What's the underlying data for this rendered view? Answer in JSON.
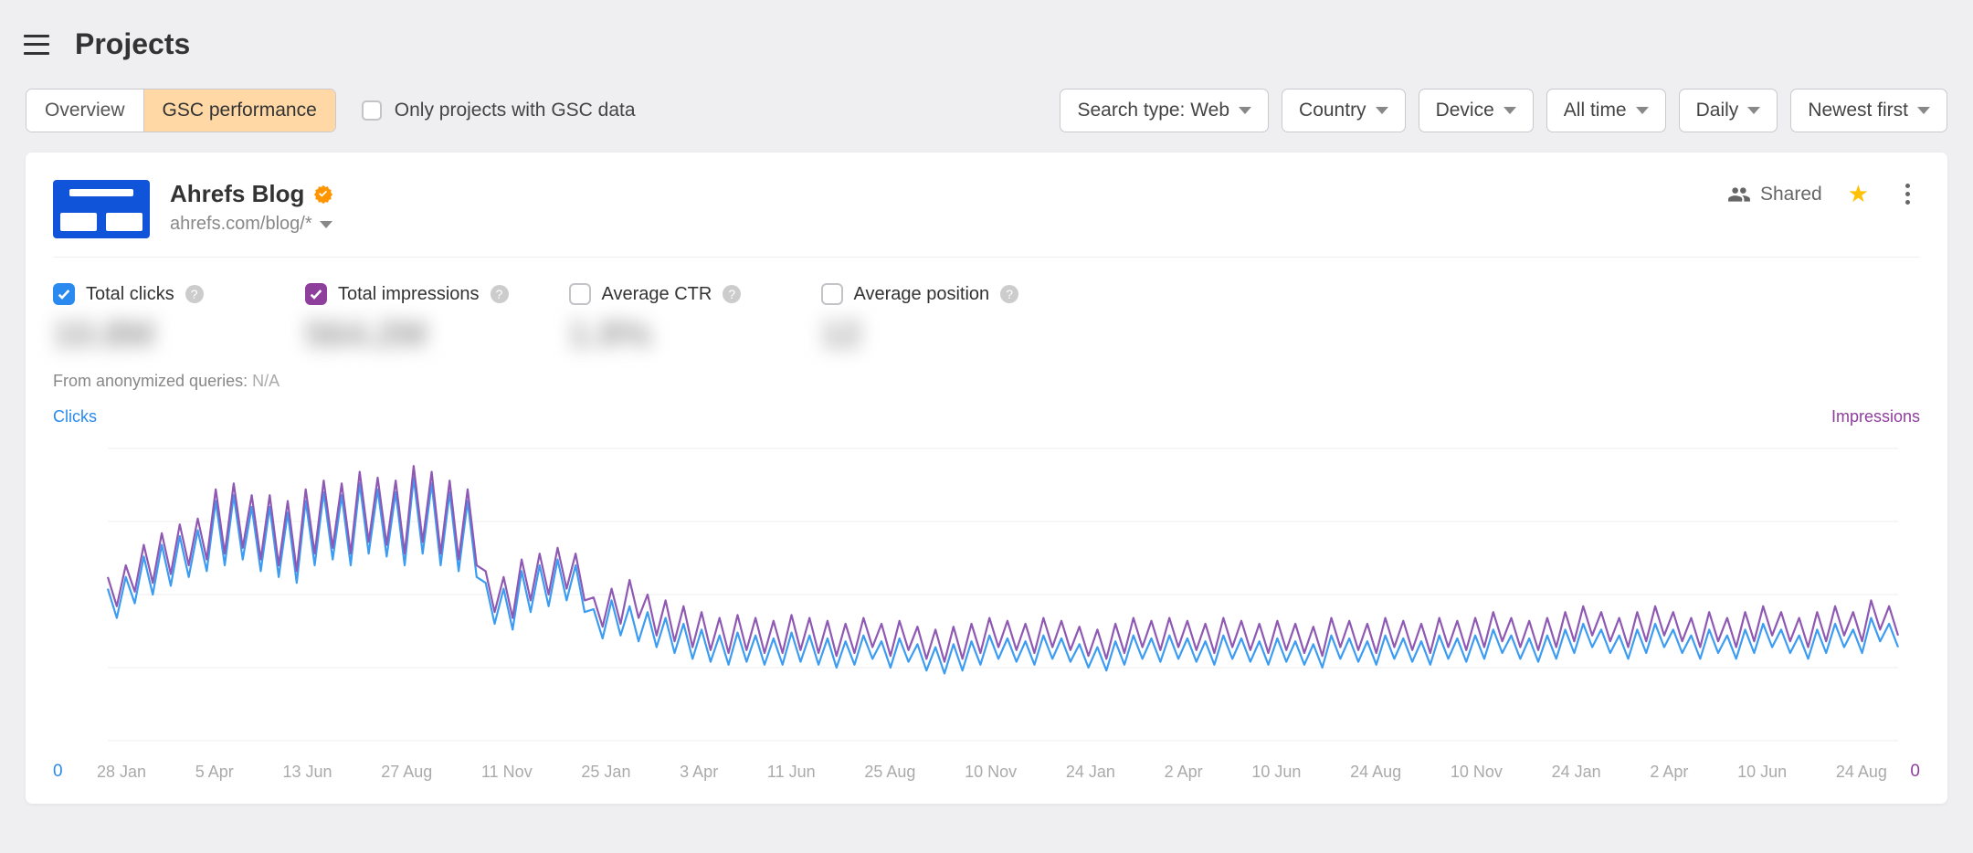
{
  "page": {
    "title": "Projects"
  },
  "tabs": {
    "overview": "Overview",
    "gsc": "GSC performance"
  },
  "only_gsc": {
    "label": "Only projects with GSC data",
    "checked": false
  },
  "filters": {
    "search_type": "Search type: Web",
    "country": "Country",
    "device": "Device",
    "time": "All time",
    "granularity": "Daily",
    "sort": "Newest first"
  },
  "project": {
    "name": "Ahrefs Blog",
    "domain": "ahrefs.com/blog/*",
    "shared_label": "Shared"
  },
  "metrics": {
    "total_clicks": {
      "label": "Total clicks",
      "value": "10.8M",
      "checked": true
    },
    "total_impressions": {
      "label": "Total impressions",
      "value": "564.2M",
      "checked": true
    },
    "avg_ctr": {
      "label": "Average CTR",
      "value": "1.9%",
      "checked": false
    },
    "avg_position": {
      "label": "Average position",
      "value": "12",
      "checked": false
    }
  },
  "anon": {
    "label": "From anonymized queries:",
    "value": "N/A"
  },
  "axis": {
    "left_label": "Clicks",
    "right_label": "Impressions",
    "left_zero": "0",
    "right_zero": "0"
  },
  "xticks": [
    "28 Jan",
    "5 Apr",
    "13 Jun",
    "27 Aug",
    "11 Nov",
    "25 Jan",
    "3 Apr",
    "11 Jun",
    "25 Aug",
    "10 Nov",
    "24 Jan",
    "2 Apr",
    "10 Jun",
    "24 Aug",
    "10 Nov",
    "24 Jan",
    "2 Apr",
    "10 Jun",
    "24 Aug"
  ],
  "chart_data": {
    "type": "line",
    "xlabel": "",
    "ylabel_left": "Clicks",
    "ylabel_right": "Impressions",
    "x_ticks": [
      "28 Jan",
      "5 Apr",
      "13 Jun",
      "27 Aug",
      "11 Nov",
      "25 Jan",
      "3 Apr",
      "11 Jun",
      "25 Aug",
      "10 Nov",
      "24 Jan",
      "2 Apr",
      "10 Jun",
      "24 Aug",
      "10 Nov",
      "24 Jan",
      "2 Apr",
      "10 Jun",
      "24 Aug"
    ],
    "ylim": [
      0,
      100
    ],
    "series": [
      {
        "name": "Total clicks",
        "color": "#3b9cf2",
        "values": [
          52,
          42,
          56,
          47,
          63,
          50,
          67,
          53,
          70,
          56,
          72,
          58,
          82,
          60,
          84,
          62,
          80,
          58,
          80,
          56,
          78,
          54,
          82,
          60,
          85,
          62,
          84,
          60,
          88,
          64,
          86,
          63,
          85,
          60,
          90,
          64,
          88,
          60,
          85,
          58,
          82,
          56,
          54,
          40,
          52,
          38,
          58,
          44,
          60,
          46,
          62,
          48,
          60,
          44,
          45,
          35,
          48,
          36,
          46,
          34,
          44,
          32,
          42,
          30,
          40,
          28,
          38,
          27,
          36,
          26,
          37,
          27,
          36,
          26,
          35,
          26,
          37,
          27,
          36,
          26,
          35,
          25,
          34,
          26,
          36,
          28,
          34,
          25,
          35,
          27,
          33,
          24,
          32,
          23,
          33,
          24,
          34,
          26,
          36,
          28,
          35,
          27,
          34,
          26,
          36,
          28,
          35,
          27,
          33,
          25,
          32,
          24,
          34,
          26,
          36,
          28,
          35,
          27,
          36,
          28,
          35,
          27,
          34,
          26,
          36,
          28,
          35,
          27,
          34,
          26,
          35,
          27,
          34,
          26,
          33,
          25,
          36,
          28,
          35,
          27,
          34,
          26,
          36,
          28,
          35,
          27,
          34,
          26,
          36,
          28,
          35,
          27,
          36,
          28,
          38,
          30,
          36,
          28,
          35,
          27,
          36,
          28,
          38,
          30,
          40,
          32,
          38,
          30,
          36,
          28,
          38,
          30,
          40,
          32,
          38,
          30,
          36,
          28,
          38,
          30,
          36,
          28,
          38,
          30,
          40,
          32,
          38,
          30,
          36,
          28,
          38,
          30,
          40,
          32,
          38,
          30,
          42,
          34,
          40,
          32
        ]
      },
      {
        "name": "Total impressions",
        "color": "#8e58b3",
        "values": [
          56,
          46,
          60,
          51,
          67,
          54,
          71,
          57,
          74,
          60,
          76,
          62,
          86,
          64,
          88,
          66,
          84,
          62,
          84,
          60,
          82,
          58,
          86,
          64,
          89,
          66,
          88,
          64,
          92,
          68,
          90,
          67,
          89,
          64,
          94,
          68,
          92,
          64,
          89,
          62,
          86,
          60,
          58,
          44,
          56,
          42,
          62,
          48,
          64,
          50,
          66,
          52,
          64,
          48,
          49,
          39,
          52,
          40,
          55,
          42,
          50,
          36,
          48,
          34,
          46,
          32,
          44,
          31,
          42,
          30,
          43,
          31,
          42,
          30,
          41,
          30,
          43,
          31,
          42,
          30,
          41,
          29,
          40,
          30,
          42,
          32,
          40,
          29,
          41,
          31,
          39,
          28,
          38,
          27,
          39,
          28,
          40,
          30,
          42,
          32,
          41,
          31,
          40,
          30,
          42,
          32,
          41,
          31,
          39,
          29,
          38,
          28,
          40,
          30,
          42,
          32,
          41,
          31,
          42,
          32,
          41,
          31,
          40,
          30,
          42,
          32,
          41,
          31,
          40,
          30,
          41,
          31,
          40,
          30,
          39,
          29,
          42,
          32,
          41,
          31,
          40,
          30,
          42,
          32,
          41,
          31,
          40,
          30,
          42,
          32,
          41,
          31,
          42,
          32,
          44,
          34,
          42,
          32,
          41,
          31,
          42,
          32,
          44,
          34,
          46,
          36,
          44,
          34,
          42,
          32,
          44,
          34,
          46,
          36,
          44,
          34,
          42,
          32,
          44,
          34,
          42,
          32,
          44,
          34,
          46,
          36,
          44,
          34,
          42,
          32,
          44,
          34,
          46,
          36,
          44,
          34,
          48,
          38,
          46,
          36
        ]
      }
    ]
  }
}
